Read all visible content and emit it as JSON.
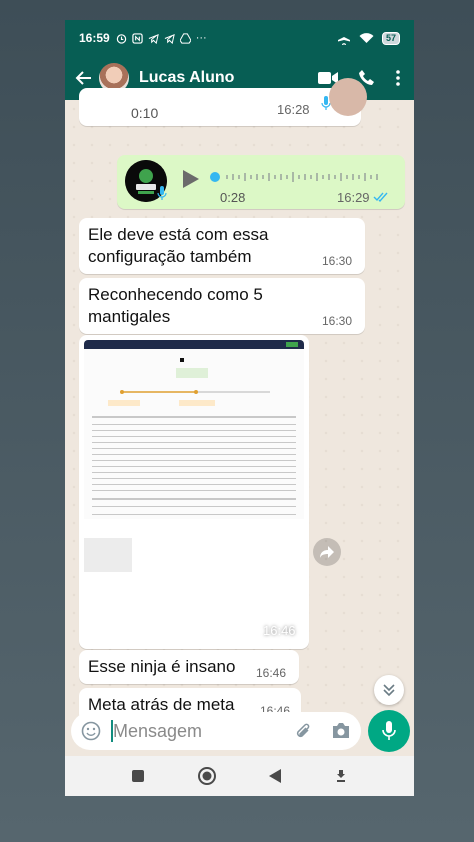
{
  "status_bar": {
    "time": "16:59",
    "battery": "57",
    "left_icons": [
      "alarm-icon",
      "nfc-icon",
      "telegram-icon",
      "telegram-icon",
      "drive-icon",
      "more-icon"
    ],
    "right_icons": [
      "airplane-icon",
      "wifi-icon",
      "battery-icon"
    ]
  },
  "header": {
    "contact_name": "Lucas Aluno",
    "actions": [
      "video-call-icon",
      "phone-icon",
      "menu-icon"
    ]
  },
  "messages": [
    {
      "type": "audio",
      "direction": "in",
      "duration": "0:10",
      "time": "16:28"
    },
    {
      "type": "audio",
      "direction": "out",
      "duration": "0:28",
      "time": "16:29",
      "status": "read"
    },
    {
      "type": "text",
      "direction": "in",
      "text": "Ele deve está com essa configuração também",
      "time": "16:30"
    },
    {
      "type": "text",
      "direction": "in",
      "text": "Reconhecendo como 5 mantigales",
      "time": "16:30"
    },
    {
      "type": "image",
      "direction": "in",
      "time": "16:46"
    },
    {
      "type": "text",
      "direction": "in",
      "text": "Esse ninja é insano",
      "time": "16:46"
    },
    {
      "type": "text",
      "direction": "in",
      "text": "Meta atrás de meta",
      "time": "16:46"
    }
  ],
  "composer": {
    "placeholder": "Mensagem"
  },
  "colors": {
    "header": "#075e54",
    "outgoing_bubble": "#dcf8c6",
    "accent": "#00a884",
    "chat_bg": "#efe7de"
  }
}
